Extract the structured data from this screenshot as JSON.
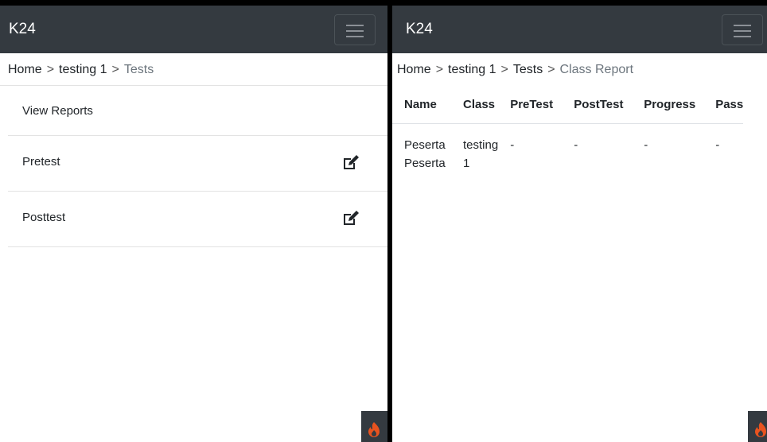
{
  "left": {
    "navbar": {
      "brand": "K24"
    },
    "breadcrumb": {
      "home": "Home",
      "sep": ">",
      "class": "testing 1",
      "current": "Tests"
    },
    "list": [
      {
        "label": "View Reports"
      },
      {
        "label": "Pretest"
      },
      {
        "label": "Posttest"
      }
    ]
  },
  "right": {
    "navbar": {
      "brand": "K24"
    },
    "breadcrumb": {
      "home": "Home",
      "sep": ">",
      "class": "testing 1",
      "tests": "Tests",
      "current": "Class Report"
    },
    "table": {
      "headers": [
        "Name",
        "Class",
        "PreTest",
        "PostTest",
        "Progress",
        "Pass"
      ],
      "rows": [
        {
          "name": "Peserta Peserta",
          "class": "testing 1",
          "pretest": "-",
          "posttest": "-",
          "progress": "-",
          "pass": "-"
        }
      ]
    }
  },
  "colors": {
    "navbar": "#343a40",
    "fire": "#e8531f"
  },
  "icons": [
    "menu-icon",
    "edit-icon",
    "fire-icon"
  ]
}
